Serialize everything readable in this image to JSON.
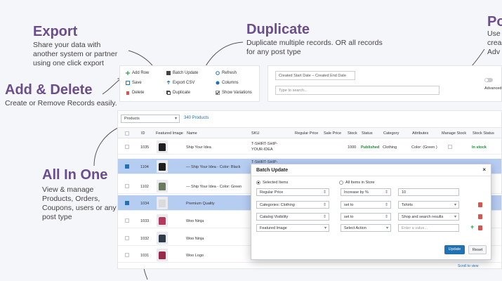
{
  "callouts": {
    "export": {
      "title": "Export",
      "desc": "Share your data with another system or partner using one click export"
    },
    "duplicate": {
      "title": "Duplicate",
      "desc": "Duplicate multiple records. OR all records for any post type"
    },
    "add_delete": {
      "title": "Add & Delete",
      "desc": "Create or Remove Records easily."
    },
    "all_in_one": {
      "title": "All In One",
      "desc": "View & manage Products, Orders, Coupons, users or any post type"
    },
    "power": {
      "title": "Po",
      "desc_1": "Use",
      "desc_2": "crea",
      "desc_3": "Adv"
    }
  },
  "toolbar": {
    "add_row": "Add Row",
    "save": "Save",
    "delete": "Delete",
    "batch_update": "Batch Update",
    "export_csv": "Export CSV",
    "duplicate": "Duplicate",
    "refresh": "Refresh",
    "columns": "Columns",
    "show_variations": "Show Variations"
  },
  "filters": {
    "start_date": "Created Start Date",
    "end_date": "Created End Date",
    "search_placeholder": "Type to search...",
    "advanced": "Advanced"
  },
  "table": {
    "post_type": "Products",
    "count": "340 Products",
    "headers": [
      "ID",
      "Featured Image",
      "Name",
      "SKU",
      "Regular Price",
      "Sale Price",
      "Stock",
      "Status",
      "Category",
      "Attributes",
      "Manage Stock",
      "Stock Status"
    ],
    "rows": [
      {
        "id": "1035",
        "name": "Ship Your Idea",
        "sku_1": "T-SHIRT-SHIP-",
        "sku_2": "YOUR-IDEA",
        "stock": "1000",
        "status": "Published",
        "category": "Clothing",
        "attributes": "Color: (Green )",
        "stock_status": "In stock"
      },
      {
        "id": "1104",
        "name": "— Ship Your Idea - Color: Black",
        "sku_1": "T-SHIRT-SHIP-"
      },
      {
        "id": "1102",
        "name": "— Ship Your Idea - Color: Green"
      },
      {
        "id": "1034",
        "name": "Premium Quality"
      },
      {
        "id": "1033",
        "name": "Woo Ninja"
      },
      {
        "id": "1032",
        "name": "Woo Ninja"
      },
      {
        "id": "1031",
        "name": "Woo Logo"
      }
    ],
    "scroll_note": "Scroll to view"
  },
  "modal": {
    "title": "Batch Update",
    "close": "×",
    "selected_items": "Selected Items",
    "all_items": "All Items in Store",
    "rows": [
      {
        "field": "Regular Price",
        "action": "Increase by %",
        "value": "10"
      },
      {
        "field": "Categories: Clothing",
        "action": "set to",
        "value": "Tshirts"
      },
      {
        "field": "Catalog Visibility",
        "action": "set to",
        "value": "Shop and search results"
      },
      {
        "field": "Featured Image",
        "action": "Select Action",
        "value": "Enter a value..."
      }
    ],
    "update": "Update",
    "reset": "Reset"
  },
  "colors": {
    "accent": "#6b4d8e",
    "primary": "#2271b1",
    "selected_row": "#b6cdf2",
    "stock_green": "#1e8a3a"
  },
  "icons": [
    "plus-icon",
    "save-icon",
    "trash-icon",
    "grid-icon",
    "export-icon",
    "copy-icon",
    "refresh-icon",
    "columns-icon",
    "eye-icon",
    "close-icon"
  ]
}
